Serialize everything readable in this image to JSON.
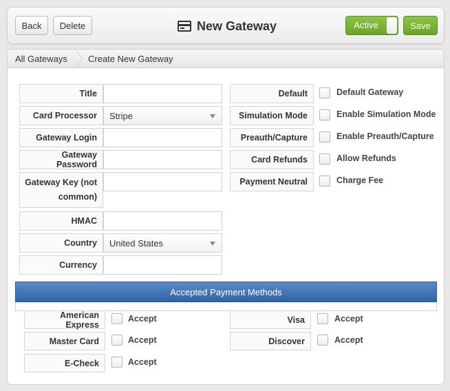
{
  "toolbar": {
    "back_label": "Back",
    "delete_label": "Delete",
    "title": "New Gateway",
    "active_label": "Active",
    "save_label": "Save",
    "active_on": true,
    "accent_color": "#7bb534"
  },
  "breadcrumb": {
    "root": "All Gateways",
    "current": "Create New Gateway"
  },
  "form": {
    "title": {
      "label": "Title",
      "value": ""
    },
    "card_processor": {
      "label": "Card Processor",
      "value": "Stripe"
    },
    "gateway_login": {
      "label": "Gateway Login",
      "value": ""
    },
    "gateway_password": {
      "label": "Gateway Password",
      "value": ""
    },
    "gateway_key": {
      "label_line1": "Gateway Key (not",
      "label_line2": "common)",
      "value": ""
    },
    "hmac": {
      "label": "HMAC",
      "value": ""
    },
    "country": {
      "label": "Country",
      "value": "United States"
    },
    "currency": {
      "label": "Currency",
      "value": ""
    }
  },
  "options": {
    "default": {
      "label": "Default",
      "checkbox_label": "Default Gateway",
      "checked": false
    },
    "simulation_mode": {
      "label": "Simulation Mode",
      "checkbox_label": "Enable Simulation Mode",
      "checked": false
    },
    "preauth_capture": {
      "label": "Preauth/Capture",
      "checkbox_label": "Enable Preauth/Capture",
      "checked": false
    },
    "card_refunds": {
      "label": "Card Refunds",
      "checkbox_label": "Allow Refunds",
      "checked": false
    },
    "payment_neutral": {
      "label": "Payment Neutral",
      "checkbox_label": "Charge Fee",
      "checked": false
    }
  },
  "payment_methods": {
    "header": "Accepted Payment Methods",
    "american_express": {
      "label": "American Express",
      "checkbox_label": "Accept",
      "checked": false
    },
    "visa": {
      "label": "Visa",
      "checkbox_label": "Accept",
      "checked": false
    },
    "master_card": {
      "label": "Master Card",
      "checkbox_label": "Accept",
      "checked": false
    },
    "discover": {
      "label": "Discover",
      "checkbox_label": "Accept",
      "checked": false
    },
    "echeck": {
      "label": "E-Check",
      "checkbox_label": "Accept",
      "checked": false
    }
  }
}
